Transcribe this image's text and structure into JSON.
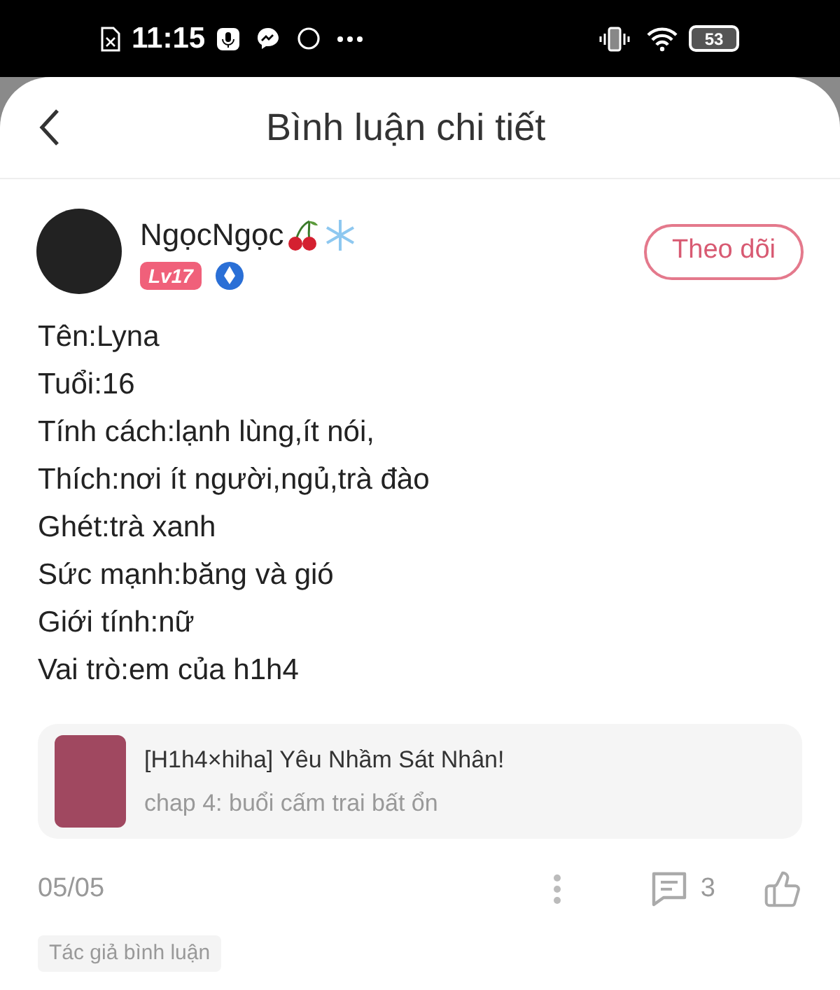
{
  "status_bar": {
    "time": "11:15",
    "battery": "53"
  },
  "header": {
    "title": "Bình luận chi tiết"
  },
  "author": {
    "name": "NgọcNgọc",
    "level": "Lv17",
    "follow_button": "Theo dõi"
  },
  "comment_lines": [
    "Tên:Lyna",
    "Tuổi:16",
    "Tính cách:lạnh lùng,ít nói,",
    "Thích:nơi ít người,ngủ,trà đào",
    "Ghét:trà xanh",
    "Sức mạnh:băng và gió",
    "Giới tính:nữ",
    "Vai trò:em của h1h4"
  ],
  "story": {
    "title": "[H1h4×hiha] Yêu Nhầm Sát Nhân!",
    "chapter": "chap 4: buổi cấm trai bất ổn"
  },
  "footer": {
    "date": "05/05",
    "reply_count": "3"
  },
  "tag": "Tác giả bình luận"
}
